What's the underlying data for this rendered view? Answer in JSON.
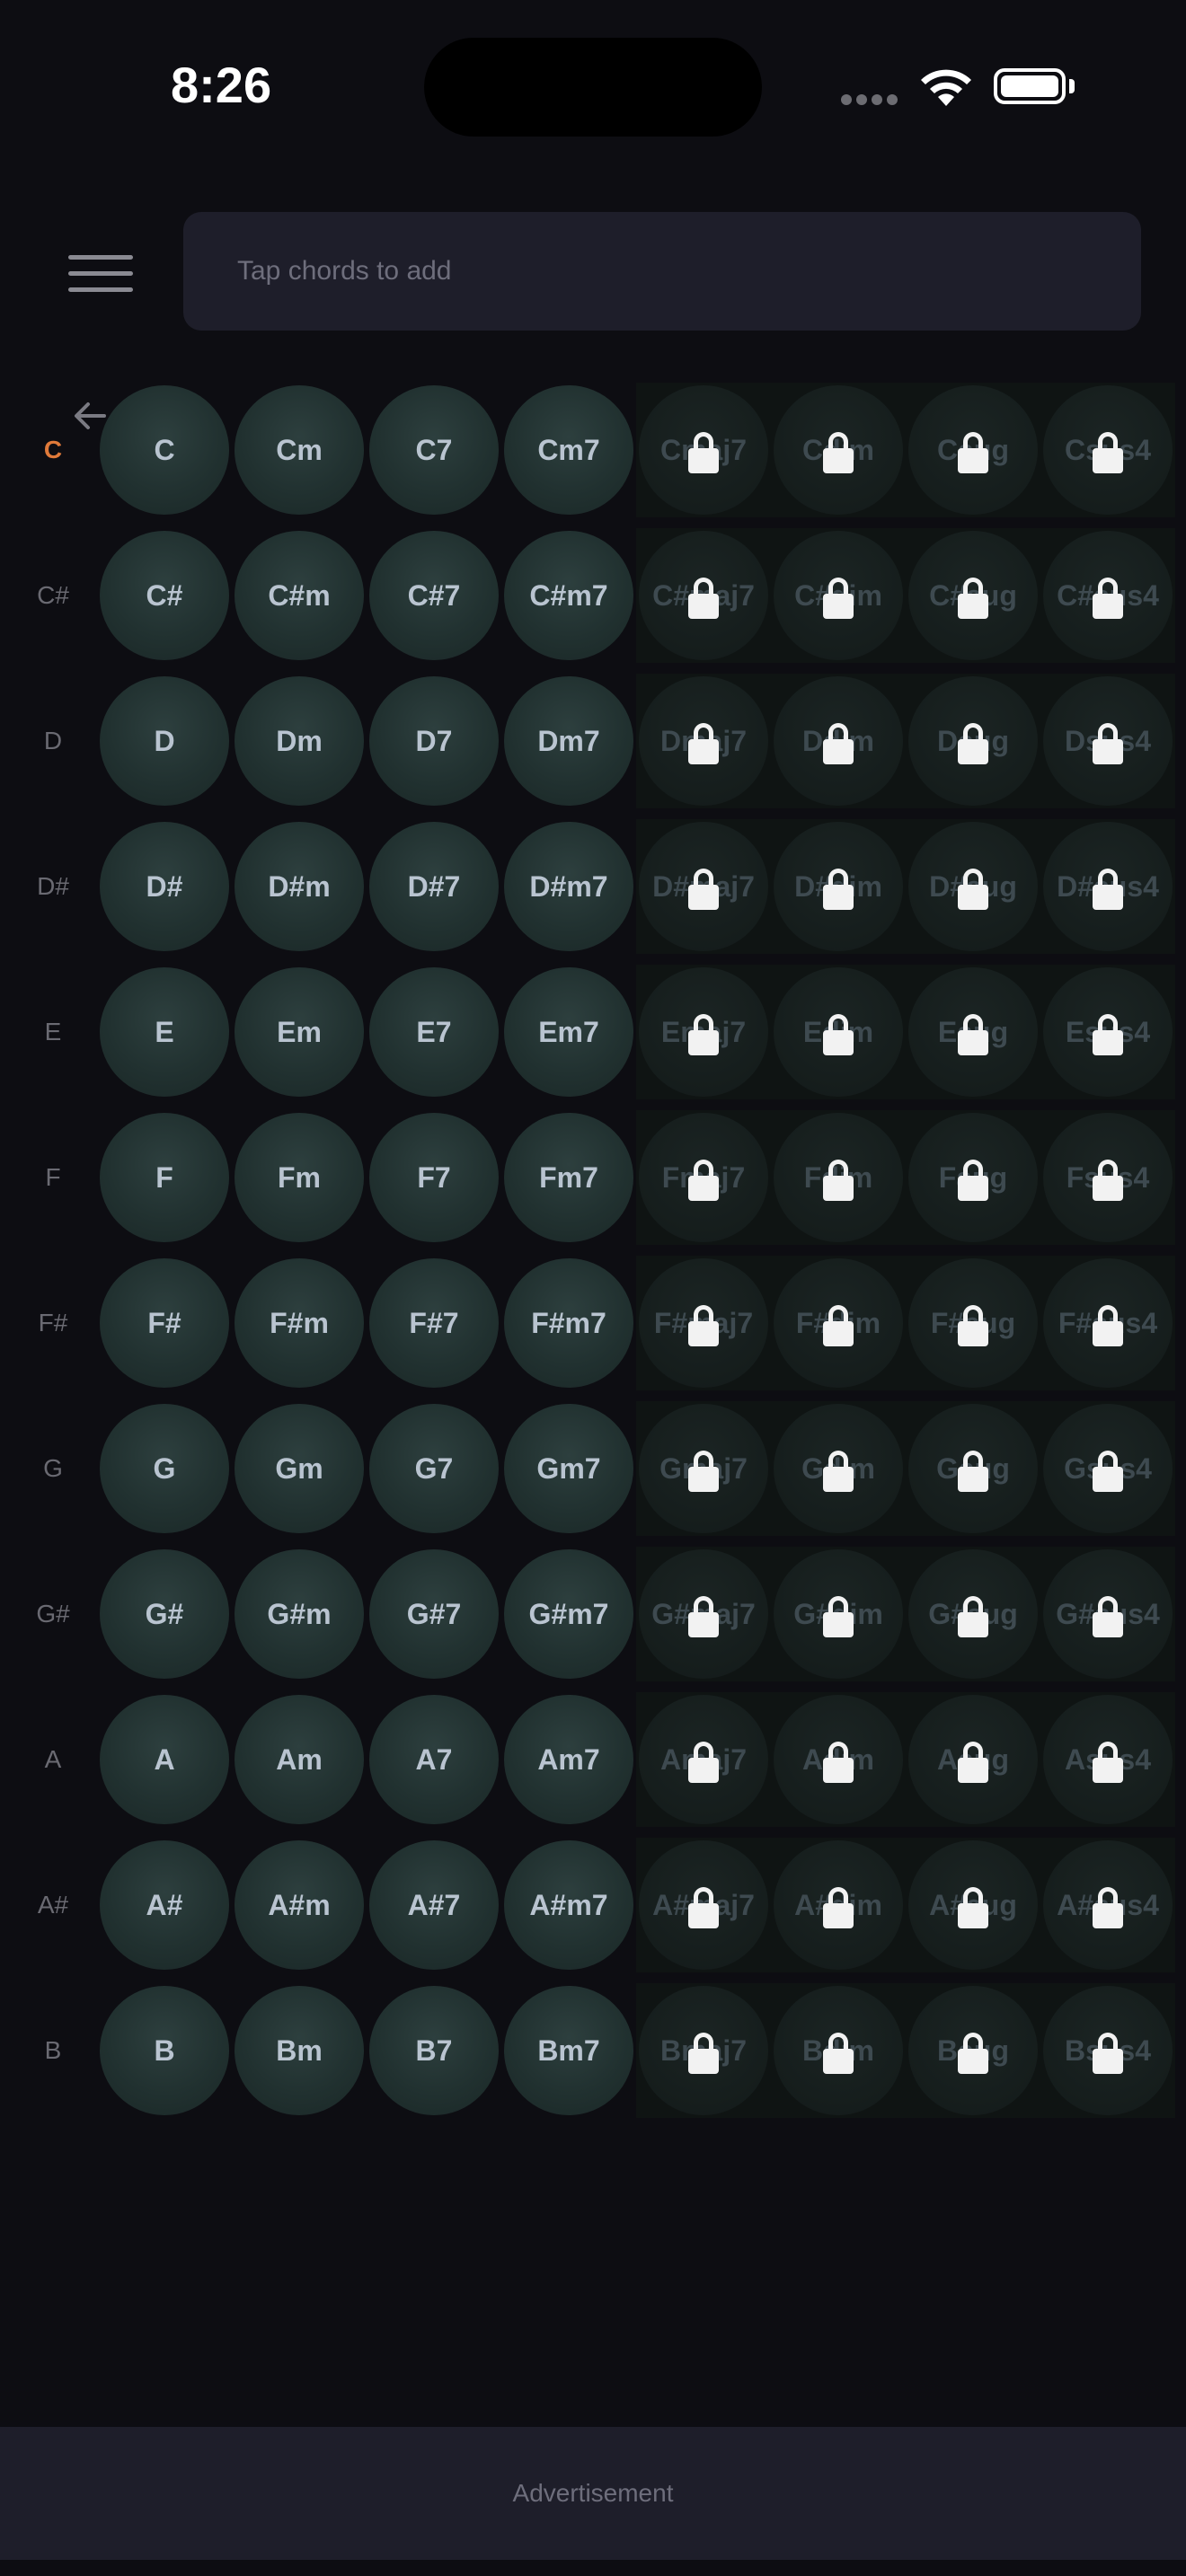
{
  "status_bar": {
    "time": "8:26"
  },
  "header": {
    "search_placeholder": "Tap chords to add"
  },
  "ad": {
    "label": "Advertisement"
  },
  "colors": {
    "background": "#0d0d12",
    "accent_row_label": "#e07a3a",
    "chord_text": "#b9c4d0"
  },
  "icons": {
    "menu": "hamburger-icon",
    "back": "back-arrow-icon",
    "lock": "lock-icon"
  },
  "selected_row": "C",
  "rows": [
    {
      "label": "C",
      "free": [
        "C",
        "Cm",
        "C7",
        "Cm7"
      ],
      "locked": [
        "Cmaj7",
        "Cdim",
        "Caug",
        "Csus4"
      ]
    },
    {
      "label": "C#",
      "free": [
        "C#",
        "C#m",
        "C#7",
        "C#m7"
      ],
      "locked": [
        "C#maj7",
        "C#dim",
        "C#aug",
        "C#sus4"
      ]
    },
    {
      "label": "D",
      "free": [
        "D",
        "Dm",
        "D7",
        "Dm7"
      ],
      "locked": [
        "Dmaj7",
        "Ddim",
        "Daug",
        "Dsus4"
      ]
    },
    {
      "label": "D#",
      "free": [
        "D#",
        "D#m",
        "D#7",
        "D#m7"
      ],
      "locked": [
        "D#maj7",
        "D#dim",
        "D#aug",
        "D#sus4"
      ]
    },
    {
      "label": "E",
      "free": [
        "E",
        "Em",
        "E7",
        "Em7"
      ],
      "locked": [
        "Emaj7",
        "Edim",
        "Eaug",
        "Esus4"
      ]
    },
    {
      "label": "F",
      "free": [
        "F",
        "Fm",
        "F7",
        "Fm7"
      ],
      "locked": [
        "Fmaj7",
        "Fdim",
        "Faug",
        "Fsus4"
      ]
    },
    {
      "label": "F#",
      "free": [
        "F#",
        "F#m",
        "F#7",
        "F#m7"
      ],
      "locked": [
        "F#maj7",
        "F#dim",
        "F#aug",
        "F#sus4"
      ]
    },
    {
      "label": "G",
      "free": [
        "G",
        "Gm",
        "G7",
        "Gm7"
      ],
      "locked": [
        "Gmaj7",
        "Gdim",
        "Gaug",
        "Gsus4"
      ]
    },
    {
      "label": "G#",
      "free": [
        "G#",
        "G#m",
        "G#7",
        "G#m7"
      ],
      "locked": [
        "G#maj7",
        "G#dim",
        "G#aug",
        "G#sus4"
      ]
    },
    {
      "label": "A",
      "free": [
        "A",
        "Am",
        "A7",
        "Am7"
      ],
      "locked": [
        "Amaj7",
        "Adim",
        "Aaug",
        "Asus4"
      ]
    },
    {
      "label": "A#",
      "free": [
        "A#",
        "A#m",
        "A#7",
        "A#m7"
      ],
      "locked": [
        "A#maj7",
        "A#dim",
        "A#aug",
        "A#sus4"
      ]
    },
    {
      "label": "B",
      "free": [
        "B",
        "Bm",
        "B7",
        "Bm7"
      ],
      "locked": [
        "Bmaj7",
        "Bdim",
        "Baug",
        "Bsus4"
      ]
    }
  ]
}
